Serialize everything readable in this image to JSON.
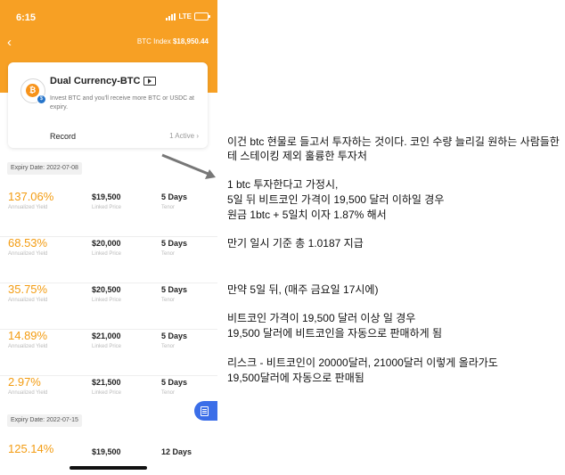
{
  "status_bar": {
    "time": "6:15",
    "network": "LTE"
  },
  "header": {
    "back": "‹",
    "btc_index_label": "BTC Index",
    "btc_index_value": "$18,950.44"
  },
  "product": {
    "title": "Dual Currency-BTC",
    "description": "Invest BTC and you'll receive more BTC or USDC at expiry.",
    "record_label": "Record",
    "active_status": "1 Active",
    "chevron": "›"
  },
  "labels": {
    "annualized": "Annualized Yield",
    "linked": "Linked Price",
    "tenor": "Tenor"
  },
  "groups": [
    {
      "expiry": "Expiry Date: 2022-07-08",
      "rows": [
        {
          "yield": "137.06%",
          "price": "$19,500",
          "days": "5 Days"
        },
        {
          "yield": "68.53%",
          "price": "$20,000",
          "days": "5 Days"
        },
        {
          "yield": "35.75%",
          "price": "$20,500",
          "days": "5 Days"
        },
        {
          "yield": "14.89%",
          "price": "$21,000",
          "days": "5 Days"
        },
        {
          "yield": "2.97%",
          "price": "$21,500",
          "days": "5 Days"
        }
      ]
    },
    {
      "expiry": "Expiry Date: 2022-07-15",
      "rows": [
        {
          "yield": "125.14%",
          "price": "$19,500",
          "days": "12 Days"
        }
      ]
    }
  ],
  "annotations": [
    "이건 btc 현물로 들고서 투자하는 것이다. 코인 수량 늘리길 원하는 사람들한테 스테이킹 제외 훌륭한 투자처",
    "1 btc 투자한다고 가정시,",
    "5일 뒤 비트코인 가격이 19,500 달러 이하일 경우",
    "원금 1btc + 5일치 이자 1.87% 해서",
    "만기 일시 기준 총 1.0187 지급",
    "만약 5일 뒤, (매주 금요일 17시에)",
    "비트코인 가격이 19,500 달러 이상 일 경우",
    "19,500 달러에 비트코인을 자동으로 판매하게 됨",
    "리스크 - 비트코인이 20000달러, 21000달러 이렇게 올라가도",
    "19,500달러에 자동으로 판매됨"
  ],
  "colors": {
    "header": "#f7a024",
    "yield": "#f39c12",
    "fab": "#3b6ee8",
    "arrow": "#777777"
  }
}
